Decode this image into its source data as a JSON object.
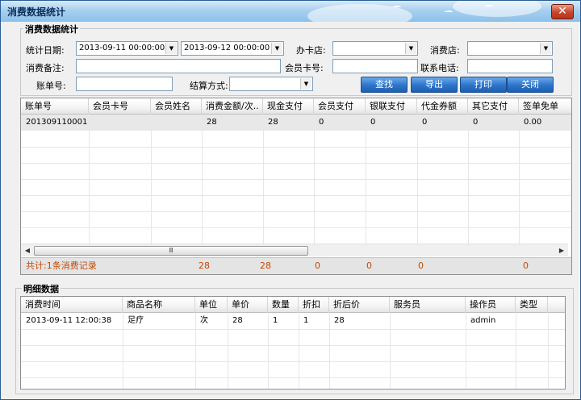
{
  "window": {
    "title": "消费数据统计",
    "close_symbol": "✕"
  },
  "filter": {
    "group_title": "消费数据统计",
    "stat_date_label": "统计日期:",
    "date_from": "2013-09-11 00:00:00",
    "date_to": "2013-09-12 00:00:00",
    "card_store_label": "办卡店:",
    "card_store_value": "",
    "consume_store_label": "消费店:",
    "consume_store_value": "",
    "remark_label": "消费备注:",
    "remark_value": "",
    "card_no_label": "会员卡号:",
    "card_no_value": "",
    "phone_label": "联系电话:",
    "phone_value": "",
    "bill_no_label": "账单号:",
    "bill_no_value": "",
    "settle_label": "结算方式:",
    "settle_value": "",
    "buttons": {
      "search": "查找",
      "export": "导出",
      "print": "打印",
      "close": "关闭"
    }
  },
  "summary_table": {
    "columns": [
      "账单号",
      "会员卡号",
      "会员姓名",
      "消费金额/次..",
      "现金支付",
      "会员支付",
      "银联支付",
      "代金券额",
      "其它支付",
      "签单免单"
    ],
    "rows": [
      [
        "201309110001",
        "",
        "",
        "28",
        "28",
        "0",
        "0",
        "0",
        "0",
        "0.00"
      ]
    ],
    "scroll_thumb": "Ⅲ",
    "total_label": "共计:1条消费记录",
    "totals": [
      "28",
      "28",
      "0",
      "0",
      "0",
      "0"
    ]
  },
  "detail": {
    "group_title": "明细数据",
    "columns": [
      "消费时间",
      "商品名称",
      "单位",
      "单价",
      "数量",
      "折扣",
      "折后价",
      "服务员",
      "操作员",
      "类型"
    ],
    "rows": [
      [
        "2013-09-11 12:00:38",
        "足疗",
        "次",
        "28",
        "1",
        "1",
        "28",
        "",
        "admin",
        ""
      ]
    ]
  }
}
